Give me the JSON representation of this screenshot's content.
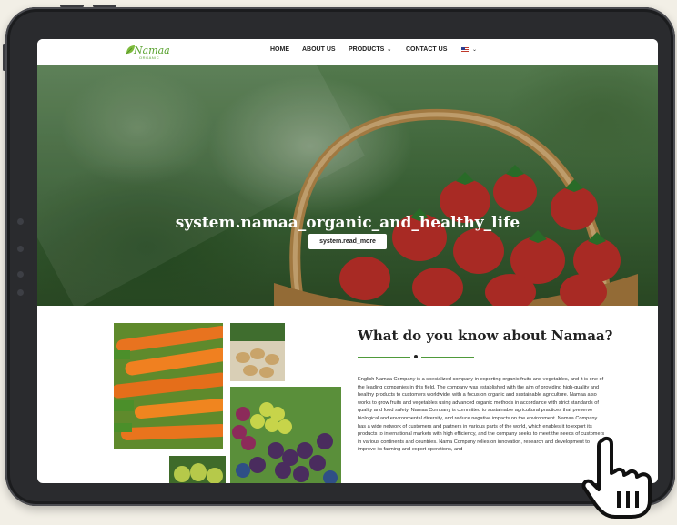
{
  "nav": {
    "logo_text": "Namaa",
    "logo_sub": "ORGANIC",
    "home": "HOME",
    "about": "ABOUT US",
    "products": "PRODUCTS",
    "contact": "CONTACT US",
    "products_chevron": "⌄",
    "lang_chevron": "⌄"
  },
  "hero": {
    "title": "system.namaa_organic_and_healthy_life",
    "button": "system.read_more"
  },
  "about": {
    "title": "What do you know about Namaa?",
    "body": "English Namaa Company is a specialized company in exporting organic fruits and vegetables, and it is one of the leading companies in this field. The company was established with the aim of providing high-quality and healthy products to customers worldwide, with a focus on organic and sustainable agriculture. Namaa also works to grow fruits and vegetables using advanced organic methods in accordance with strict standards of quality and food safety. Namaa Company is committed to sustainable agricultural practices that preserve biological and environmental diversity, and reduce negative impacts on the environment. Namaa Company has a wide network of customers and partners in various parts of the world, which enables it to export its products to international markets with high efficiency, and the company seeks to meet the needs of customers in various continents and countries. Nama Company relies on innovation, research and development to improve its farming and export operations, and"
  },
  "colors": {
    "brand_green": "#5aa330",
    "divider_green": "#4f9a3a"
  }
}
